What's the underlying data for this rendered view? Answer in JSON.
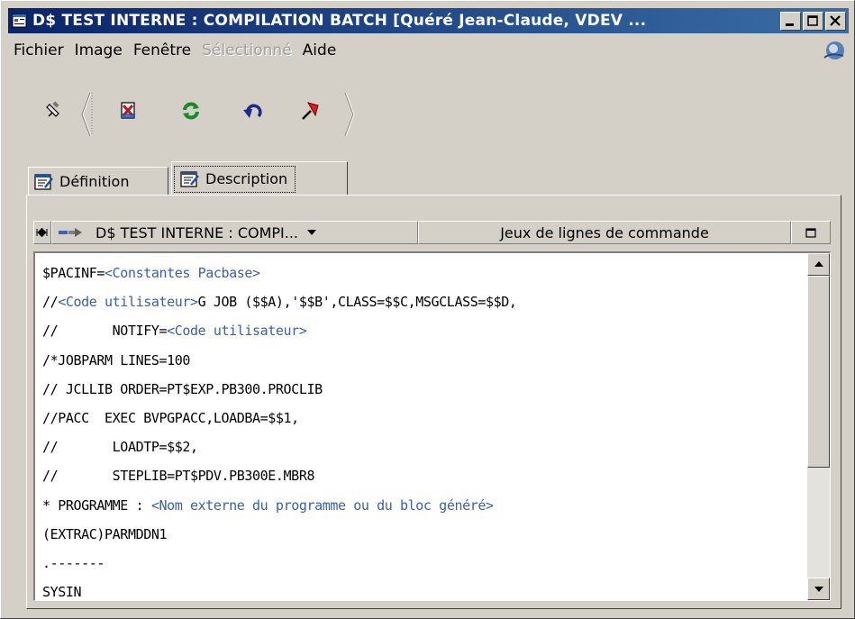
{
  "window": {
    "title": "D$ TEST INTERNE : COMPILATION BATCH [Quéré Jean-Claude, VDEV ...",
    "title_icon": "document-icon",
    "controls": [
      "minimize-icon",
      "maximize-icon",
      "close-icon"
    ]
  },
  "menubar": {
    "items": [
      {
        "label": "Fichier",
        "enabled": true
      },
      {
        "label": "Image",
        "enabled": true
      },
      {
        "label": "Fenêtre",
        "enabled": true
      },
      {
        "label": "Sélectionné",
        "enabled": false
      },
      {
        "label": "Aide",
        "enabled": true
      }
    ],
    "logo_icon": "globe-logo-icon"
  },
  "toolbar": {
    "buttons": [
      {
        "icon": "pin-icon"
      },
      {
        "icon": "delete-document-icon"
      },
      {
        "icon": "refresh-icon"
      },
      {
        "icon": "undo-icon"
      },
      {
        "icon": "pin-red-icon"
      }
    ]
  },
  "tabs": [
    {
      "label": "Définition",
      "icon": "edit-document-icon",
      "selected": false
    },
    {
      "label": "Description",
      "icon": "edit-document-icon",
      "selected": true
    }
  ],
  "subbar": {
    "nav_icon": "first-last-icon",
    "arrow_icon": "arrow-right-icon",
    "entity": "D$ TEST INTERNE : COMPI...",
    "section": "Jeux de lignes de commande",
    "maximize_icon": "maximize-icon"
  },
  "editor": {
    "lines": [
      [
        {
          "t": "$PACINF="
        },
        {
          "t": "<Constantes Pacbase>",
          "ph": true
        }
      ],
      [
        {
          "t": "//"
        },
        {
          "t": "<Code utilisateur>",
          "ph": true
        },
        {
          "t": "G JOB ($$A),'$$B',CLASS=$$C,MSGCLASS=$$D,"
        }
      ],
      [
        {
          "t": "//       NOTIFY="
        },
        {
          "t": "<Code utilisateur>",
          "ph": true
        }
      ],
      [
        {
          "t": "/*JOBPARM LINES=100"
        }
      ],
      [
        {
          "t": "// JCLLIB ORDER=PT$EXP.PB300.PROCLIB"
        }
      ],
      [
        {
          "t": "//PACC  EXEC BVPGPACC,LOADBA=$$1,"
        }
      ],
      [
        {
          "t": "//       LOADTP=$$2,"
        }
      ],
      [
        {
          "t": "//       STEPLIB=PT$PDV.PB300E.MBR8"
        }
      ],
      [
        {
          "t": "* PROGRAMME : "
        },
        {
          "t": "<Nom externe du programme ou du bloc généré>",
          "ph": true
        }
      ],
      [
        {
          "t": "(EXTRAC)PARMDDN1"
        }
      ],
      [
        {
          "t": ".-------"
        }
      ],
      [
        {
          "t": "SYSIN"
        }
      ]
    ]
  }
}
